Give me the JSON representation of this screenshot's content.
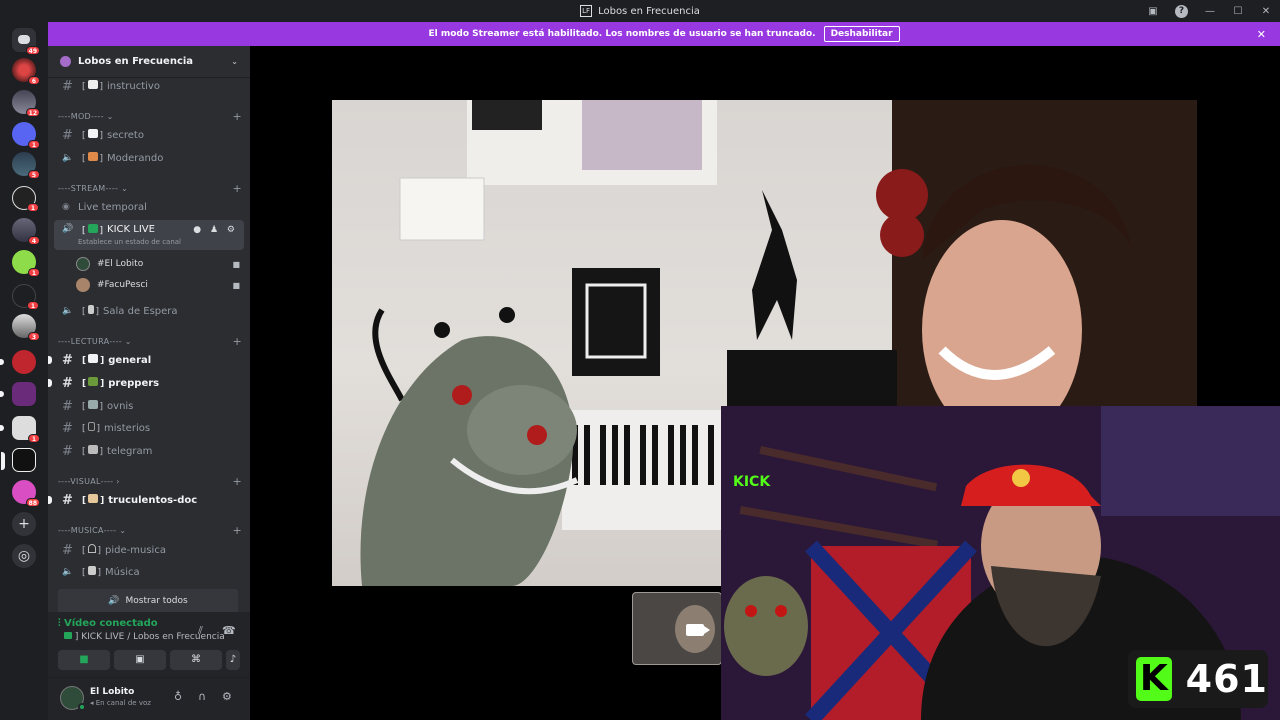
{
  "window": {
    "title": "Lobos en Frecuencia"
  },
  "banner": {
    "message": "El modo Streamer está habilitado. Los nombres de usuario se han truncado.",
    "button": "Deshabilitar"
  },
  "rail": {
    "home_badge": "49",
    "server_badges": [
      "6",
      "12",
      "1",
      "5",
      "1",
      "4",
      "1",
      "1",
      "3",
      "1",
      "88"
    ]
  },
  "guild": {
    "name": "Lobos en Frecuencia"
  },
  "channels": {
    "instructivo": "instructivo",
    "cat_mod": "----MOD----",
    "secreto": "secreto",
    "moderando": "Moderando",
    "cat_stream": "----STREAM----",
    "live_temporal": "Live temporal",
    "kick_live": "KICK LIVE",
    "kick_live_status": "Establece un estado de canal",
    "voice_users": [
      "#El Lobito",
      "#FacuPesci"
    ],
    "sala_espera": "Sala de Espera",
    "cat_lectura": "----LECTURA----",
    "general": "general",
    "preppers": "preppers",
    "ovnis": "ovnis",
    "misterios": "misterios",
    "telegram": "telegram",
    "cat_visual": "----VISUAL----",
    "truculentos": "truculentos-doc",
    "cat_musica": "----MUSICA----",
    "pide_musica": "pide-musica",
    "musica": "Música",
    "show_all": "Mostrar todos"
  },
  "voice_panel": {
    "status": "Vídeo conectado",
    "location": "KICK LIVE / Lobos en Frecuencia"
  },
  "user_panel": {
    "name": "El Lobito",
    "status": "En canal de voz"
  },
  "stream": {
    "viewer_count": "461",
    "platform_letter": "K"
  },
  "colors": {
    "banner": "#9838e0",
    "connected": "#23a55a",
    "kick": "#53fc18"
  }
}
